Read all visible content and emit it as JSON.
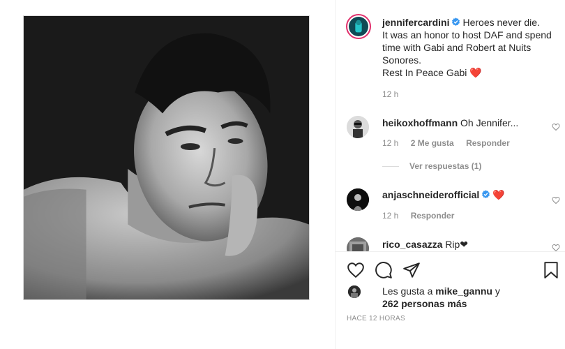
{
  "post": {
    "author": "jennifercardini",
    "caption_lines": [
      "Heroes never die.",
      "It was an honor to host DAF and spend",
      "time with Gabi and Robert at Nuits",
      "Sonores.",
      "Rest In Peace Gabi ❤️"
    ],
    "caption_time": "12 h",
    "timestamp": "HACE 12 HORAS"
  },
  "comments": [
    {
      "username": "heikoxhoffmann",
      "text": "Oh Jennifer...",
      "time": "12 h",
      "likes": "2 Me gusta",
      "reply": "Responder",
      "view_replies": "Ver respuestas (1)"
    },
    {
      "username": "anjaschneiderofficial",
      "text": "❤️",
      "time": "12 h",
      "reply": "Responder",
      "verified": true
    },
    {
      "username": "rico_casazza",
      "text": "Rip❤"
    }
  ],
  "likes": {
    "prefix": "Les gusta a ",
    "user": "mike_gannu",
    "suffix": " y",
    "others": "262 personas más"
  },
  "colors": {
    "verified": "#3897f0",
    "heart": "#ed4956",
    "muted": "#8e8e8e",
    "text": "#262626"
  },
  "icons": [
    "heart-icon",
    "comment-icon",
    "share-icon",
    "bookmark-icon",
    "verified-icon"
  ]
}
